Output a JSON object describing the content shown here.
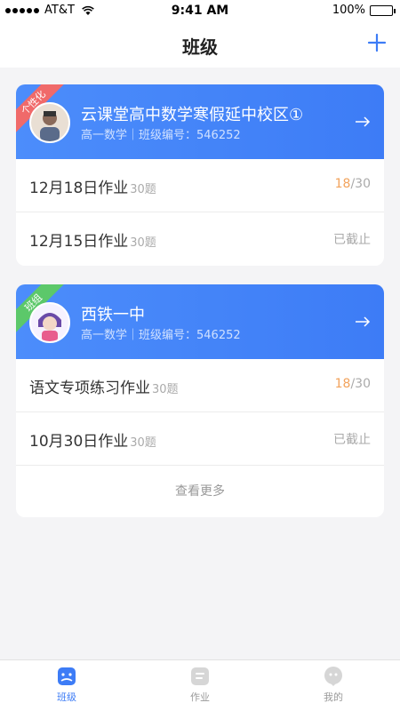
{
  "status_bar": {
    "carrier": "AT&T",
    "time": "9:41 AM",
    "battery": "100%",
    "battery_level": 1.0
  },
  "nav": {
    "title": "班级",
    "add_icon": "plus-icon"
  },
  "classes": [
    {
      "ribbon": "个性化",
      "ribbon_color": "#f06a6a",
      "name": "云课堂高中数学寒假延中校区①",
      "meta": "高一数学｜班级编号：546252",
      "homework": [
        {
          "title": "12月18日作业",
          "count": "30题",
          "done": "18",
          "total": "/30"
        },
        {
          "title": "12月15日作业",
          "count": "30题",
          "status": "已截止"
        }
      ]
    },
    {
      "ribbon": "班组",
      "ribbon_color": "#5cc86a",
      "name": "西铁一中",
      "meta": "高一数学｜班级编号：546252",
      "homework": [
        {
          "title": "语文专项练习作业",
          "count": "30题",
          "done": "18",
          "total": "/30"
        },
        {
          "title": "10月30日作业",
          "count": "30题",
          "status": "已截止"
        }
      ],
      "more": "查看更多"
    }
  ],
  "tabbar": [
    {
      "label": "班级",
      "icon": "class-icon",
      "active": true
    },
    {
      "label": "作业",
      "icon": "homework-icon",
      "active": false
    },
    {
      "label": "我的",
      "icon": "profile-icon",
      "active": false
    }
  ],
  "colors": {
    "accent": "#3d7cf6",
    "done": "#f2a35c",
    "muted": "#aaaaaa"
  }
}
